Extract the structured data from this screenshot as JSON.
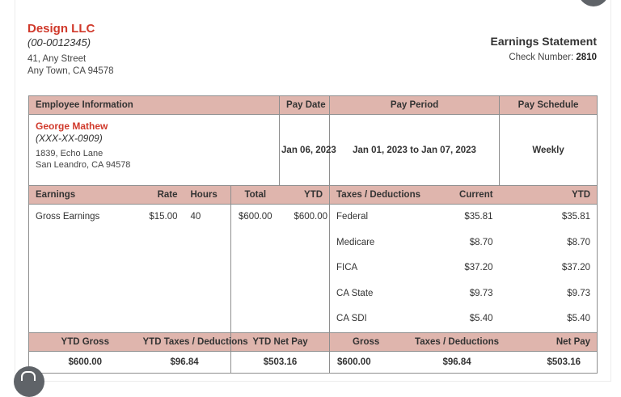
{
  "company": {
    "name": "Design LLC",
    "id": "(00-0012345)",
    "address_line1": "41, Any Street",
    "address_line2": "Any Town, CA 94578"
  },
  "statement": {
    "title": "Earnings Statement",
    "check_label": "Check Number:",
    "check_number": "2810"
  },
  "headers": {
    "employee_info": "Employee Information",
    "pay_date": "Pay Date",
    "pay_period": "Pay Period",
    "pay_schedule": "Pay Schedule"
  },
  "employee": {
    "name": "George Mathew",
    "ssn": "(XXX-XX-0909)",
    "address_line1": "1839, Echo Lane",
    "address_line2": "San Leandro, CA 94578"
  },
  "pay": {
    "date": "Jan 06, 2023",
    "period": "Jan 01, 2023 to Jan 07, 2023",
    "schedule": "Weekly"
  },
  "earnings_headers": {
    "earnings": "Earnings",
    "rate": "Rate",
    "hours": "Hours",
    "total": "Total",
    "ytd": "YTD",
    "taxes": "Taxes / Deductions",
    "current": "Current",
    "ytd2": "YTD"
  },
  "earnings_row": {
    "label": "Gross Earnings",
    "rate": "$15.00",
    "hours": "40",
    "total": "$600.00",
    "ytd": "$600.00"
  },
  "deductions": [
    {
      "name": "Federal",
      "current": "$35.81",
      "ytd": "$35.81"
    },
    {
      "name": "Medicare",
      "current": "$8.70",
      "ytd": "$8.70"
    },
    {
      "name": "FICA",
      "current": "$37.20",
      "ytd": "$37.20"
    },
    {
      "name": "CA State",
      "current": "$9.73",
      "ytd": "$9.73"
    },
    {
      "name": "CA SDI",
      "current": "$5.40",
      "ytd": "$5.40"
    }
  ],
  "summary_headers": {
    "ytd_gross": "YTD Gross",
    "ytd_taxes": "YTD Taxes / Deductions",
    "ytd_net": "YTD Net Pay",
    "gross": "Gross",
    "taxes": "Taxes / Deductions",
    "net": "Net Pay"
  },
  "summary_values": {
    "ytd_gross": "$600.00",
    "ytd_taxes": "$96.84",
    "ytd_net": "$503.16",
    "gross": "$600.00",
    "taxes": "$96.84",
    "net": "$503.16"
  },
  "colors": {
    "header_bg": "#dfb5ad",
    "accent": "#d0392b"
  }
}
